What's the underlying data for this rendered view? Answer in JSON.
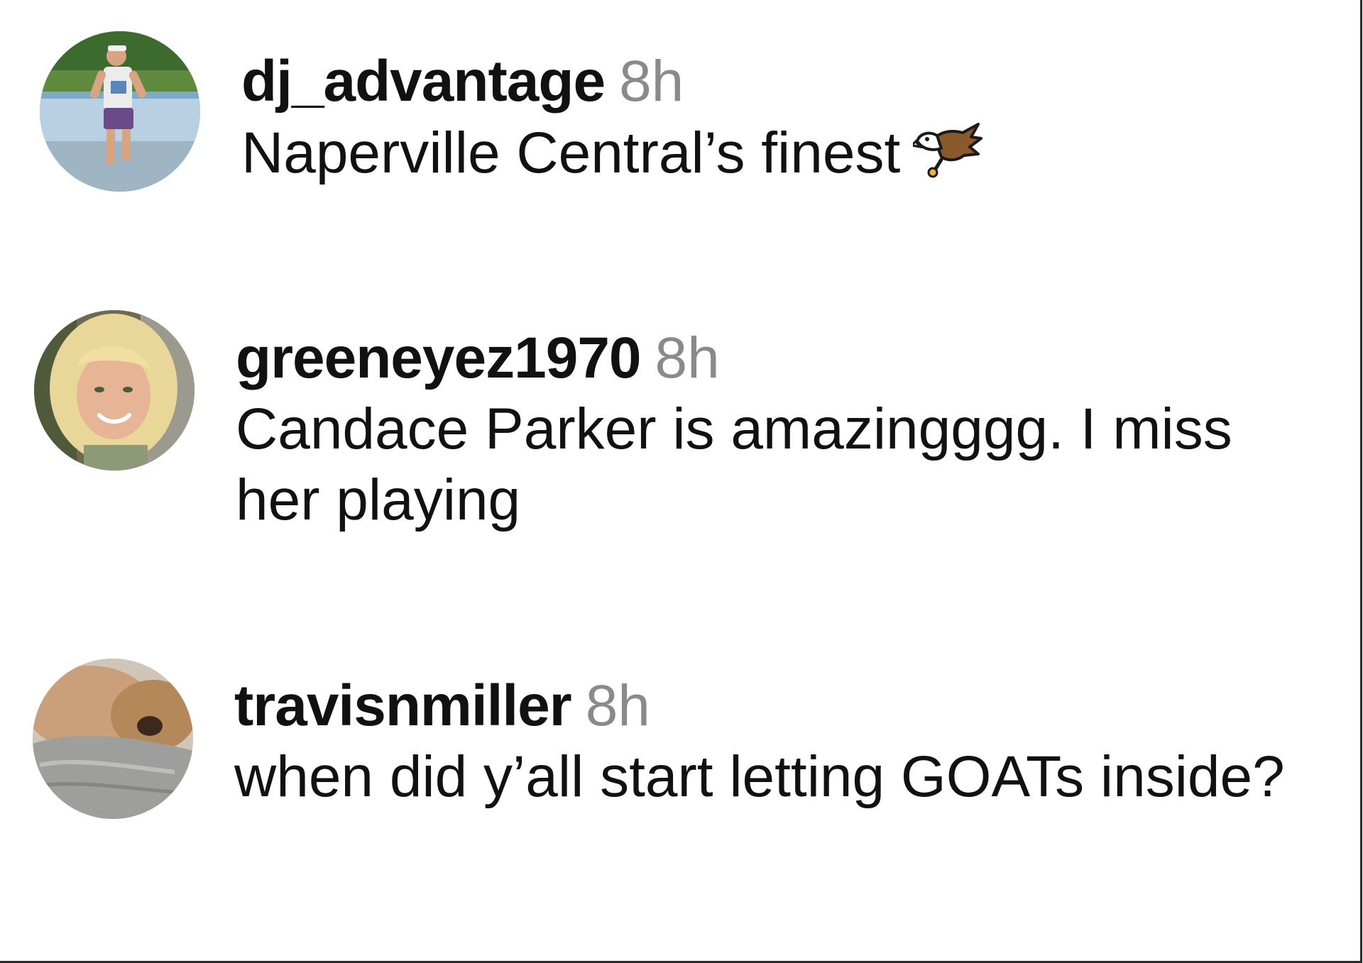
{
  "comments": [
    {
      "username": "dj_advantage",
      "time": "8h",
      "text": "Naperville Central’s finest",
      "avatar": "runner-photo-avatar",
      "emoji": "eagle-icon"
    },
    {
      "username": "greeneyez1970",
      "time": "8h",
      "text": "Candace Parker is amazingggg. I miss her playing",
      "avatar": "blonde-woman-photo-avatar"
    },
    {
      "username": "travisnmiller",
      "time": "8h",
      "text": "when did y’all start letting GOATs inside?",
      "avatar": "dog-on-blanket-photo-avatar"
    }
  ],
  "colors": {
    "username": "#111111",
    "timestamp": "#8a8a8a",
    "text": "#111111",
    "background": "#ffffff"
  }
}
